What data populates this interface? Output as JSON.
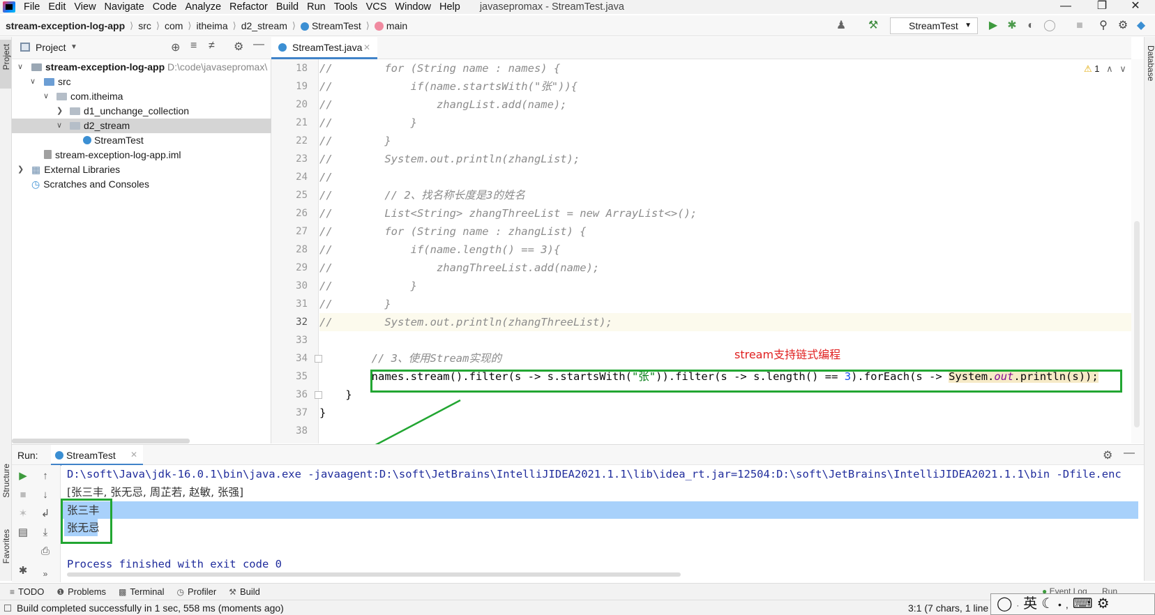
{
  "window": {
    "title": "javasepromax - StreamTest.java",
    "menu": [
      "File",
      "Edit",
      "View",
      "Navigate",
      "Code",
      "Analyze",
      "Refactor",
      "Build",
      "Run",
      "Tools",
      "VCS",
      "Window",
      "Help"
    ]
  },
  "breadcrumb": [
    "stream-exception-log-app",
    "src",
    "com",
    "itheima",
    "d2_stream",
    "StreamTest",
    "main"
  ],
  "toolbar": {
    "run_config": "StreamTest"
  },
  "left_stripe": {
    "project": "Project",
    "structure": "Structure",
    "favorites": "Favorites"
  },
  "right_stripe": {
    "database": "Database"
  },
  "project_panel": {
    "title": "Project",
    "tree": [
      {
        "label": "stream-exception-log-app",
        "path": "D:\\code\\javasepromax\\",
        "level": 0,
        "expanded": true,
        "kind": "module"
      },
      {
        "label": "src",
        "level": 1,
        "expanded": true,
        "kind": "folder"
      },
      {
        "label": "com.itheima",
        "level": 2,
        "expanded": true,
        "kind": "package"
      },
      {
        "label": "d1_unchange_collection",
        "level": 3,
        "expanded": false,
        "kind": "package"
      },
      {
        "label": "d2_stream",
        "level": 3,
        "expanded": true,
        "kind": "package",
        "selected": true
      },
      {
        "label": "StreamTest",
        "level": 4,
        "kind": "class"
      },
      {
        "label": "stream-exception-log-app.iml",
        "level": 1,
        "kind": "iml"
      },
      {
        "label": "External Libraries",
        "level": 0,
        "expanded": false,
        "kind": "libs"
      },
      {
        "label": "Scratches and Consoles",
        "level": 0,
        "kind": "scratch"
      }
    ]
  },
  "editor": {
    "tab": "StreamTest.java",
    "warnings": "1",
    "lines": [
      {
        "no": "18",
        "text": "//        for (String name : names) {"
      },
      {
        "no": "19",
        "text": "//            if(name.startsWith(\"张\")){"
      },
      {
        "no": "20",
        "text": "//                zhangList.add(name);"
      },
      {
        "no": "21",
        "text": "//            }"
      },
      {
        "no": "22",
        "text": "//        }"
      },
      {
        "no": "23",
        "text": "//        System.out.println(zhangList);"
      },
      {
        "no": "24",
        "text": "//"
      },
      {
        "no": "25",
        "text": "//        // 2、找名称长度是3的姓名"
      },
      {
        "no": "26",
        "text": "//        List<String> zhangThreeList = new ArrayList<>();"
      },
      {
        "no": "27",
        "text": "//        for (String name : zhangList) {"
      },
      {
        "no": "28",
        "text": "//            if(name.length() == 3){"
      },
      {
        "no": "29",
        "text": "//                zhangThreeList.add(name);"
      },
      {
        "no": "30",
        "text": "//            }"
      },
      {
        "no": "31",
        "text": "//        }"
      },
      {
        "no": "32",
        "text": "//        System.out.println(zhangThreeList);"
      },
      {
        "no": "33",
        "text": ""
      },
      {
        "no": "34",
        "text": "        // 3、使用Stream实现的"
      },
      {
        "no": "35",
        "text": ""
      },
      {
        "no": "36",
        "text": "    }"
      },
      {
        "no": "37",
        "text": "}"
      },
      {
        "no": "38",
        "text": ""
      }
    ],
    "line35": {
      "a": "        names.stream().filter(s -> s.startsWith(",
      "str": "\"张\"",
      "b": ")).filter(s -> s.length() == ",
      "num": "3",
      "c": ").forEach(s -> ",
      "sys": "System.",
      "out": "out",
      "d": ".println(s));"
    }
  },
  "annotation": {
    "label": "stream支持链式编程"
  },
  "run_panel": {
    "label": "Run:",
    "tab": "StreamTest",
    "output": [
      "D:\\soft\\Java\\jdk-16.0.1\\bin\\java.exe -javaagent:D:\\soft\\JetBrains\\IntelliJIDEA2021.1.1\\lib\\idea_rt.jar=12504:D:\\soft\\JetBrains\\IntelliJIDEA2021.1.1\\bin -Dfile.enc",
      "[张三丰, 张无忌, 周芷若, 赵敏, 张强]",
      "张三丰",
      "张无忌",
      "",
      "Process finished with exit code 0"
    ]
  },
  "tool_windows": [
    "TODO",
    "Problems",
    "Terminal",
    "Profiler",
    "Build"
  ],
  "tool_windows_right": {
    "event_log": "Event Log",
    "run": "Run"
  },
  "status": {
    "message": "Build completed successfully in 1 sec, 558 ms (moments ago)",
    "position": "3:1 (7 chars, 1 line"
  },
  "ime": {
    "text": "英"
  }
}
